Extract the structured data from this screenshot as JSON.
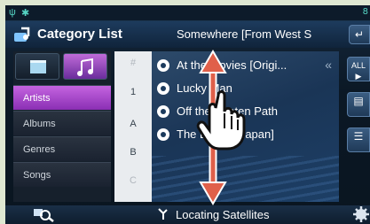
{
  "statusbar": {
    "left_icons": [
      "usb-icon",
      "bluetooth-icon"
    ],
    "right_text": "8"
  },
  "header": {
    "title": "Category List",
    "now_playing": "Somewhere [From West S",
    "top_right_icon": "return-icon"
  },
  "left_panel": {
    "type_buttons": [
      {
        "name": "video-icon",
        "selected": false
      },
      {
        "name": "music-note-icon",
        "selected": true
      }
    ],
    "categories": [
      {
        "label": "Artists",
        "selected": true
      },
      {
        "label": "Albums",
        "selected": false
      },
      {
        "label": "Genres",
        "selected": false
      },
      {
        "label": "Songs",
        "selected": false
      }
    ]
  },
  "index": [
    "#",
    "1",
    "A",
    "B",
    "C"
  ],
  "tracks": [
    {
      "label": "At the Movies [Origi..."
    },
    {
      "label": "Lucky Man"
    },
    {
      "label": "Off the Beaten Path"
    },
    {
      "label": "The Dance [Japan]"
    }
  ],
  "right_buttons": [
    {
      "label": "ALL",
      "icon": "play-icon"
    },
    {
      "label": "",
      "icon": "folder-icon"
    },
    {
      "label": "",
      "icon": "list-icon"
    }
  ],
  "footer": {
    "status": "Locating Satellites"
  },
  "gesture": {
    "arrow_color": "#e0604a",
    "icon": "swipe-hand-icon"
  },
  "colors": {
    "accent_purple": "#b24fd6",
    "header_blue": "#1d3b5d"
  }
}
